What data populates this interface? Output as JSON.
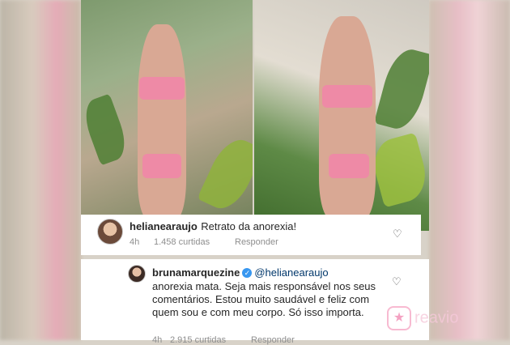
{
  "comments": [
    {
      "username": "helianearaujo",
      "text": "Retrato da anorexia!",
      "time": "4h",
      "likes": "1.458 curtidas",
      "reply_label": "Responder"
    },
    {
      "username": "brunamarquezine",
      "mention": "@helianearaujo",
      "text": "anorexia mata. Seja mais responsável nos seus comentários. Estou muito saudável e feliz com quem sou e com meu corpo. Só isso importa.",
      "time": "4h",
      "likes": "2.915 curtidas",
      "reply_label": "Responder"
    }
  ],
  "watermark": {
    "text": "reavio"
  },
  "icons": {
    "heart": "heart-icon",
    "verified": "verified-badge-icon",
    "star": "star-icon"
  },
  "colors": {
    "link": "#00376b",
    "verified": "#3897f0",
    "muted": "#8e8e8e",
    "bikini": "#ee8aa6"
  }
}
